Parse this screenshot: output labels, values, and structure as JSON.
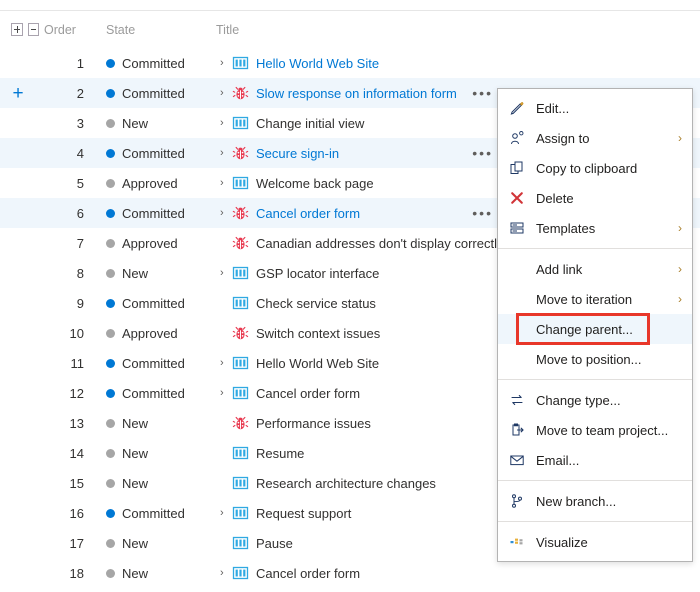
{
  "grid": {
    "columns": {
      "expander": "",
      "order": "Order",
      "state": "State",
      "title": "Title"
    },
    "header_buttons": {
      "expand_all": "+",
      "collapse_all": "−"
    },
    "rows": [
      {
        "order": "1",
        "state": "Committed",
        "state_color": "#0078d4",
        "expandable": true,
        "type": "feature",
        "title": "Hello World Web Site",
        "link": true,
        "selected": false,
        "ellipsis": false,
        "add_button": false
      },
      {
        "order": "2",
        "state": "Committed",
        "state_color": "#0078d4",
        "expandable": true,
        "type": "bug",
        "title": "Slow response on information form",
        "link": true,
        "selected": true,
        "ellipsis": true,
        "add_button": true
      },
      {
        "order": "3",
        "state": "New",
        "state_color": "#a6a6a6",
        "expandable": true,
        "type": "feature",
        "title": "Change initial view",
        "link": false,
        "selected": false,
        "ellipsis": false,
        "add_button": false
      },
      {
        "order": "4",
        "state": "Committed",
        "state_color": "#0078d4",
        "expandable": true,
        "type": "bug",
        "title": "Secure sign-in",
        "link": true,
        "selected": true,
        "ellipsis": true,
        "add_button": false
      },
      {
        "order": "5",
        "state": "Approved",
        "state_color": "#a6a6a6",
        "expandable": true,
        "type": "feature",
        "title": "Welcome back page",
        "link": false,
        "selected": false,
        "ellipsis": false,
        "add_button": false
      },
      {
        "order": "6",
        "state": "Committed",
        "state_color": "#0078d4",
        "expandable": true,
        "type": "bug",
        "title": "Cancel order form",
        "link": true,
        "selected": true,
        "ellipsis": true,
        "add_button": false
      },
      {
        "order": "7",
        "state": "Approved",
        "state_color": "#a6a6a6",
        "expandable": false,
        "type": "bug",
        "title": "Canadian addresses don't display correctly",
        "link": false,
        "selected": false,
        "ellipsis": false,
        "add_button": false
      },
      {
        "order": "8",
        "state": "New",
        "state_color": "#a6a6a6",
        "expandable": true,
        "type": "feature",
        "title": "GSP locator interface",
        "link": false,
        "selected": false,
        "ellipsis": false,
        "add_button": false
      },
      {
        "order": "9",
        "state": "Committed",
        "state_color": "#0078d4",
        "expandable": false,
        "type": "feature",
        "title": "Check service status",
        "link": false,
        "selected": false,
        "ellipsis": false,
        "add_button": false
      },
      {
        "order": "10",
        "state": "Approved",
        "state_color": "#a6a6a6",
        "expandable": false,
        "type": "bug",
        "title": "Switch context issues",
        "link": false,
        "selected": false,
        "ellipsis": false,
        "add_button": false
      },
      {
        "order": "11",
        "state": "Committed",
        "state_color": "#0078d4",
        "expandable": true,
        "type": "feature",
        "title": "Hello World Web Site",
        "link": false,
        "selected": false,
        "ellipsis": false,
        "add_button": false
      },
      {
        "order": "12",
        "state": "Committed",
        "state_color": "#0078d4",
        "expandable": true,
        "type": "feature",
        "title": "Cancel order form",
        "link": false,
        "selected": false,
        "ellipsis": false,
        "add_button": false
      },
      {
        "order": "13",
        "state": "New",
        "state_color": "#a6a6a6",
        "expandable": false,
        "type": "bug",
        "title": "Performance issues",
        "link": false,
        "selected": false,
        "ellipsis": false,
        "add_button": false
      },
      {
        "order": "14",
        "state": "New",
        "state_color": "#a6a6a6",
        "expandable": false,
        "type": "feature",
        "title": "Resume",
        "link": false,
        "selected": false,
        "ellipsis": false,
        "add_button": false
      },
      {
        "order": "15",
        "state": "New",
        "state_color": "#a6a6a6",
        "expandable": false,
        "type": "feature",
        "title": "Research architecture changes",
        "link": false,
        "selected": false,
        "ellipsis": false,
        "add_button": false
      },
      {
        "order": "16",
        "state": "Committed",
        "state_color": "#0078d4",
        "expandable": true,
        "type": "feature",
        "title": "Request support",
        "link": false,
        "selected": false,
        "ellipsis": false,
        "add_button": false
      },
      {
        "order": "17",
        "state": "New",
        "state_color": "#a6a6a6",
        "expandable": false,
        "type": "feature",
        "title": "Pause",
        "link": false,
        "selected": false,
        "ellipsis": false,
        "add_button": false
      },
      {
        "order": "18",
        "state": "New",
        "state_color": "#a6a6a6",
        "expandable": true,
        "type": "feature",
        "title": "Cancel order form",
        "link": false,
        "selected": false,
        "ellipsis": false,
        "add_button": false
      }
    ]
  },
  "context_menu": {
    "items": [
      {
        "id": "edit",
        "label": "Edit...",
        "icon": "pencil-icon",
        "submenu": false,
        "highlighted": false,
        "separator_after": false
      },
      {
        "id": "assign-to",
        "label": "Assign to",
        "icon": "person-assign-icon",
        "submenu": true,
        "highlighted": false,
        "separator_after": false
      },
      {
        "id": "copy-to-clipboard",
        "label": "Copy to clipboard",
        "icon": "copy-icon",
        "submenu": false,
        "highlighted": false,
        "separator_after": false
      },
      {
        "id": "delete",
        "label": "Delete",
        "icon": "x-delete-icon",
        "submenu": false,
        "highlighted": false,
        "separator_after": false
      },
      {
        "id": "templates",
        "label": "Templates",
        "icon": "templates-icon",
        "submenu": true,
        "highlighted": false,
        "separator_after": true
      },
      {
        "id": "add-link",
        "label": "Add link",
        "icon": "none",
        "submenu": true,
        "highlighted": false,
        "separator_after": false
      },
      {
        "id": "move-to-iteration",
        "label": "Move to iteration",
        "icon": "none",
        "submenu": true,
        "highlighted": false,
        "separator_after": false
      },
      {
        "id": "change-parent",
        "label": "Change parent...",
        "icon": "none",
        "submenu": false,
        "highlighted": true,
        "separator_after": false
      },
      {
        "id": "move-to-position",
        "label": "Move to position...",
        "icon": "none",
        "submenu": false,
        "highlighted": false,
        "separator_after": true
      },
      {
        "id": "change-type",
        "label": "Change type...",
        "icon": "change-type-icon",
        "submenu": false,
        "highlighted": false,
        "separator_after": false
      },
      {
        "id": "move-to-team",
        "label": "Move to team project...",
        "icon": "move-project-icon",
        "submenu": false,
        "highlighted": false,
        "separator_after": false
      },
      {
        "id": "email",
        "label": "Email...",
        "icon": "envelope-icon",
        "submenu": false,
        "highlighted": false,
        "separator_after": true
      },
      {
        "id": "new-branch",
        "label": "New branch...",
        "icon": "branch-icon",
        "submenu": false,
        "highlighted": false,
        "separator_after": true
      },
      {
        "id": "visualize",
        "label": "Visualize",
        "icon": "visualize-icon",
        "submenu": false,
        "highlighted": false,
        "separator_after": false
      }
    ],
    "highlight_annotation_color": "#e8372a"
  },
  "colors": {
    "accent": "#0078d4",
    "selected_row": "#eff6fc",
    "bug_icon": "#e8384f",
    "feature_icon": "#2fa9e2",
    "state_gray": "#a6a6a6",
    "annotation_red": "#e8372a"
  }
}
